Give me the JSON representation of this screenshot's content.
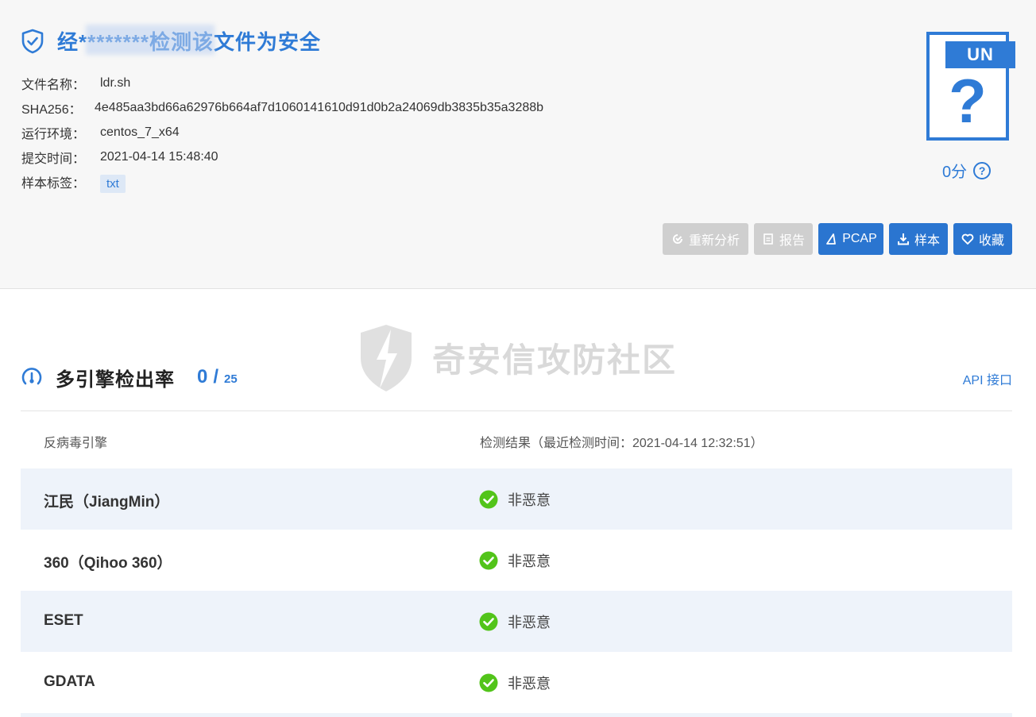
{
  "verdict": {
    "title": "经********检测该文件为安全",
    "icon": "shield-check-icon"
  },
  "file": {
    "rows": [
      {
        "key": "文件名称：",
        "value": "ldr.sh"
      },
      {
        "key": "SHA256：",
        "value": "4e485aa3bd66a62976b664af7d1060141610d91d0b2a24069db3835b35a3288b"
      },
      {
        "key": "运行环境：",
        "value": "centos_7_x64"
      },
      {
        "key": "提交时间：",
        "value": "2021-04-14 15:48:40"
      }
    ],
    "tag_key": "样本标签：",
    "tag": "txt"
  },
  "score": {
    "badge": "UN",
    "symbol": "?",
    "text": "0分",
    "help": "?"
  },
  "actions": {
    "reanalyze": "重新分析",
    "report": "报告",
    "pcap": "PCAP",
    "sample": "样本",
    "favorite": "收藏"
  },
  "watermark": "奇安信攻防社区",
  "engines": {
    "heading": "多引擎检出率",
    "hits": "0",
    "slash": "/",
    "total": "25",
    "api_link": "API 接口",
    "col_engine": "反病毒引擎",
    "col_result": "检测结果（最近检测时间：2021-04-14 12:32:51）",
    "rows": [
      {
        "name": "江民（JiangMin）",
        "result": "非恶意"
      },
      {
        "name": "360（Qihoo 360）",
        "result": "非恶意"
      },
      {
        "name": "ESET",
        "result": "非恶意"
      },
      {
        "name": "GDATA",
        "result": "非恶意"
      }
    ]
  },
  "colors": {
    "accent": "#2f7bd6",
    "ok": "#52c41a",
    "row_alt": "#eef3fa",
    "disabled": "#cfcfcf"
  }
}
